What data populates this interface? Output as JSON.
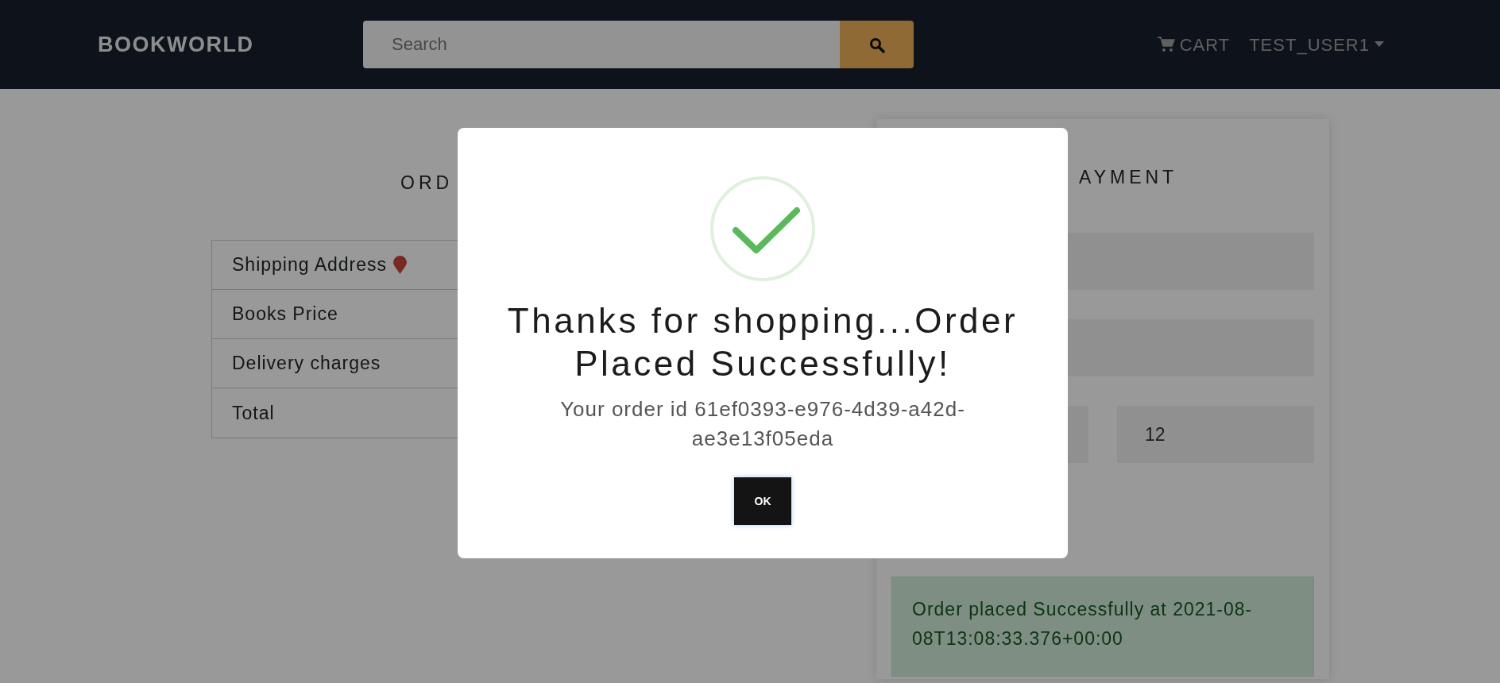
{
  "navbar": {
    "brand": "BOOKWORLD",
    "search": {
      "placeholder": "Search"
    },
    "links": [
      {
        "kind": "cart",
        "label": "CART"
      },
      {
        "kind": "dropdown",
        "label": "TEST_USER1"
      }
    ]
  },
  "summary": {
    "heading": "ORD",
    "rows": [
      {
        "kind": "address",
        "label": "Shipping Address"
      },
      {
        "kind": "plain",
        "label": "Books Price"
      },
      {
        "kind": "plain",
        "label": "Delivery charges"
      },
      {
        "kind": "plain",
        "label": "Total"
      }
    ]
  },
  "payment": {
    "heading": "AYMENT",
    "fields": [
      {
        "kind": "full"
      },
      {
        "kind": "full"
      },
      {
        "kind": "half"
      },
      {
        "kind": "half",
        "value": "12"
      }
    ],
    "alert": {
      "text": "Order placed Successfully at 2021-08-08T13:08:33.376+00:00"
    }
  },
  "modal": {
    "title": "Thanks for shopping...Order Placed Successfully!",
    "message": "Your order id 61ef0393-e976-4d39-a42d-ae3e13f05eda",
    "button": "OK"
  }
}
